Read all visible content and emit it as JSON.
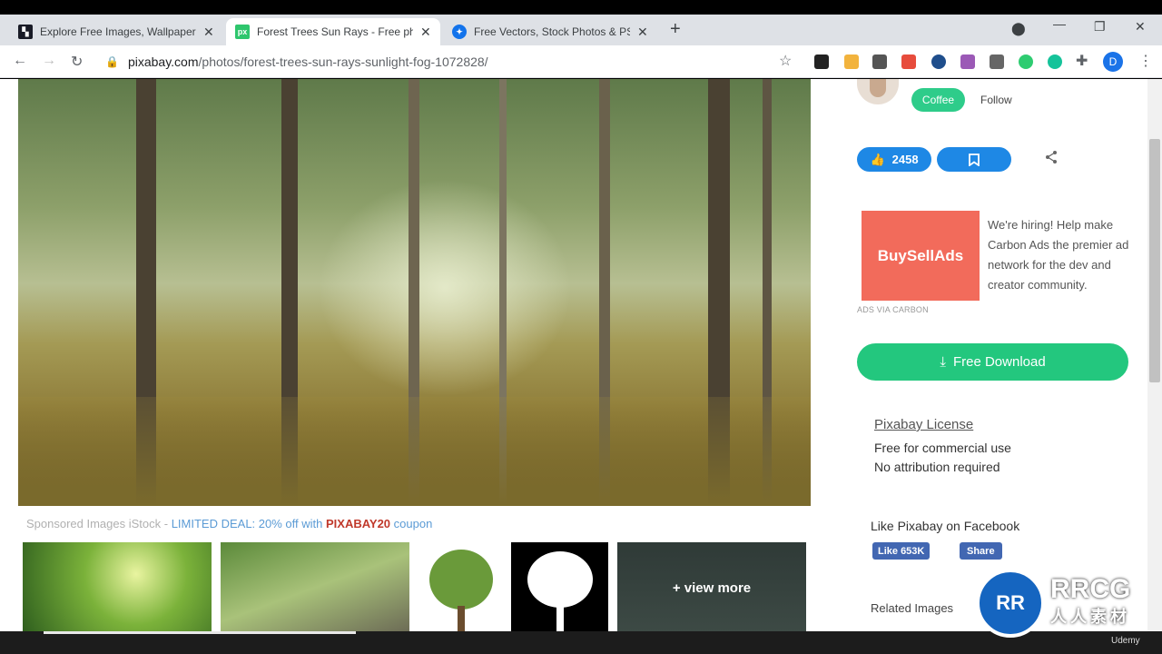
{
  "browser": {
    "tabs": [
      {
        "title": "Explore Free Images, Wallpapers",
        "favicon": "pixabay-tab-icon",
        "favicon_color": "#191b26"
      },
      {
        "title": "Forest Trees Sun Rays - Free pho",
        "favicon": "px-tab-icon",
        "favicon_text": "px",
        "favicon_color": "#2ec66d"
      },
      {
        "title": "Free Vectors, Stock Photos & PSD",
        "favicon": "freepik-tab-icon",
        "favicon_color": "#1273eb"
      }
    ],
    "url_host": "pixabay.com",
    "url_path": "/photos/forest-trees-sun-rays-sunlight-fog-1072828/",
    "profile_initial": "D"
  },
  "author": {
    "coffee_label": "Coffee",
    "follow_label": "Follow"
  },
  "actions": {
    "likes": "2458"
  },
  "ad": {
    "logo_text": "BuySellAds",
    "text": "We're hiring! Help make Carbon Ads the premier ad network for the dev and creator community.",
    "via": "ADS VIA CARBON"
  },
  "download": {
    "label": "Free Download"
  },
  "license": {
    "title": "Pixabay License",
    "line1": "Free for commercial use",
    "line2": "No attribution required"
  },
  "facebook": {
    "title": "Like Pixabay on Facebook",
    "like_label": "Like 653K",
    "share_label": "Share"
  },
  "sponsored": {
    "prefix": "Sponsored Images iStock - ",
    "deal": "LIMITED DEAL: 20% off with ",
    "code": "PIXABAY20",
    "suffix": " coupon"
  },
  "thumbs": {
    "view_more": "+ view more"
  },
  "related_label": "Related Images",
  "overlay": {
    "brand_text": "RRCG",
    "brand_sub": "人人素材",
    "udemy": "Udemy"
  },
  "colors": {
    "accent_green": "#2ecc8a",
    "download_green": "#23c77e",
    "like_blue": "#1e88e5",
    "facebook_blue": "#4267b2",
    "ad_red": "#f26b5b"
  }
}
